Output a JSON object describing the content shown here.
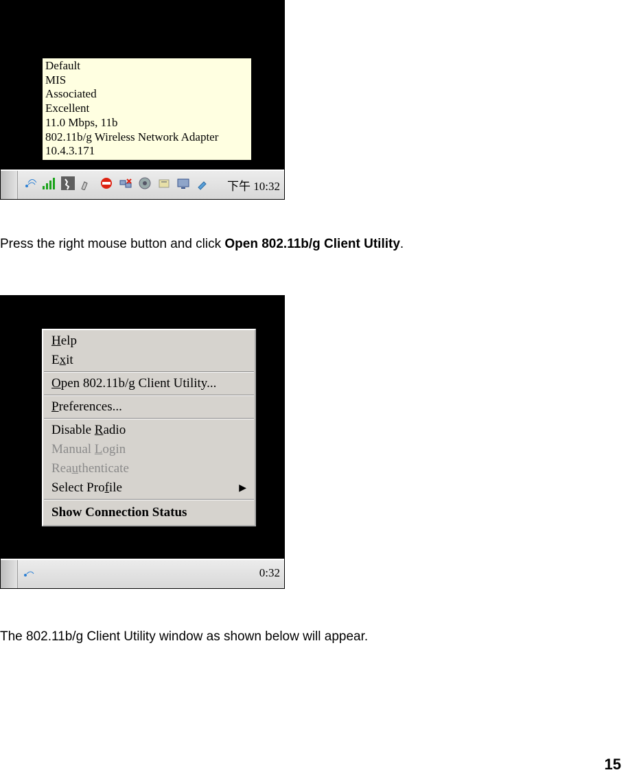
{
  "screenshot1": {
    "tooltip_lines": [
      "Default",
      "MIS",
      "Associated",
      "Excellent",
      "11.0 Mbps, 11b",
      "802.11b/g Wireless Network Adapter",
      "10.4.3.171"
    ],
    "tray_time": "下午 10:32",
    "tray_icons": [
      "wireless-icon",
      "signal-icon",
      "running-icon",
      "pen-icon",
      "blocked-icon",
      "network-x-icon",
      "volume-icon",
      "device-icon",
      "monitor-icon",
      "tool-icon"
    ]
  },
  "instruction1": {
    "prefix": "Press the right mouse button and click ",
    "bold": "Open 802.11b/g Client Utility",
    "suffix": "."
  },
  "context_menu": {
    "items": [
      {
        "label_pre": "",
        "hot": "H",
        "label_post": "elp",
        "disabled": false
      },
      {
        "label_pre": "E",
        "hot": "x",
        "label_post": "it",
        "disabled": false
      },
      {
        "sep": true
      },
      {
        "label_pre": "",
        "hot": "O",
        "label_post": "pen 802.11b/g Client Utility...",
        "disabled": false
      },
      {
        "sep": true
      },
      {
        "label_pre": "",
        "hot": "P",
        "label_post": "references...",
        "disabled": false
      },
      {
        "sep": true
      },
      {
        "label_pre": "Disable ",
        "hot": "R",
        "label_post": "adio",
        "disabled": false
      },
      {
        "label_pre": "Manual ",
        "hot": "L",
        "label_post": "ogin",
        "disabled": true
      },
      {
        "label_pre": "Rea",
        "hot": "u",
        "label_post": "thenticate",
        "disabled": true
      },
      {
        "label_pre": "Select Pro",
        "hot": "f",
        "label_post": "ile",
        "disabled": false,
        "submenu": true
      },
      {
        "sep": true
      },
      {
        "label_full": "Show Connection Status",
        "bold": true
      }
    ],
    "tray_time": "0:32"
  },
  "instruction2": "The 802.11b/g Client Utility window as shown below will appear.",
  "page_number": "15"
}
